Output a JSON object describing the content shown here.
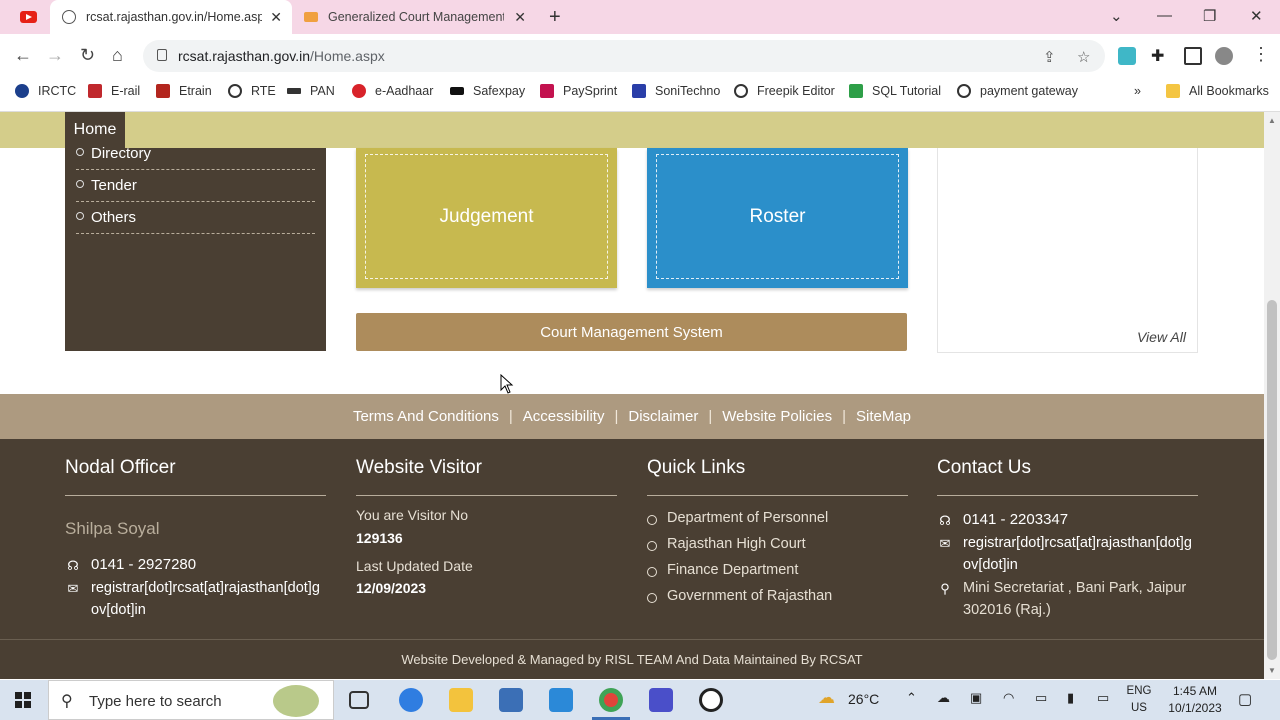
{
  "browser": {
    "tabs": [
      {
        "title": "rcsat.rajasthan.gov.in/Home.asp",
        "active": true
      },
      {
        "title": "Generalized Court Management",
        "active": false
      }
    ],
    "url_host": "rcsat.rajasthan.gov.in",
    "url_path": "/Home.aspx",
    "bookmarks": [
      "IRCTC",
      "E-rail",
      "Etrain",
      "RTE",
      "PAN",
      "e-Aadhaar",
      "Safexpay",
      "PaySprint",
      "SoniTechno",
      "Freepik Editor",
      "SQL Tutorial",
      "payment gateway"
    ],
    "all_bookmarks": "All Bookmarks",
    "more_bookmarks": "»"
  },
  "menu": {
    "home": "Home"
  },
  "left_links": [
    "Directory",
    "Tender",
    "Others"
  ],
  "tiles": {
    "judgement": "Judgement",
    "roster": "Roster",
    "cms": "Court Management System"
  },
  "news": {
    "view_all": "View All"
  },
  "footer_links": [
    "Terms And Conditions",
    "Accessibility",
    "Disclaimer",
    "Website Policies",
    "SiteMap"
  ],
  "footer": {
    "nodal": {
      "heading": "Nodal Officer",
      "name": "Shilpa Soyal",
      "phone": "0141 - 2927280",
      "email": "registrar[dot]rcsat[at]rajasthan[dot]gov[dot]in"
    },
    "visitor": {
      "heading": "Website Visitor",
      "visitor_label": "You are Visitor No",
      "visitor_no": "129136",
      "updated_label": "Last Updated Date",
      "updated_date": "12/09/2023"
    },
    "quick": {
      "heading": "Quick Links",
      "links": [
        "Department of Personnel",
        "Rajasthan High Court",
        "Finance Department",
        "Government of Rajasthan"
      ]
    },
    "contact": {
      "heading": "Contact Us",
      "phone": "0141 - 2203347",
      "email": "registrar[dot]rcsat[at]rajasthan[dot]gov[dot]in",
      "address": "Mini Secretariat , Bani Park, Jaipur 302016 (Raj.)"
    },
    "credit": "Website Developed & Managed by RISL TEAM And Data Maintained By RCSAT"
  },
  "taskbar": {
    "search_placeholder": "Type here to search",
    "weather": "26°C",
    "lang_top": "ENG",
    "lang_bottom": "US",
    "time": "1:45 AM",
    "date": "10/1/2023"
  },
  "colors": {
    "menu_bar": "#d4cd8a",
    "dark_brown": "#4a3f33",
    "judgement": "#c7b94f",
    "roster": "#2b8fca",
    "cms": "#ad8c5c",
    "footer_links_bg": "#ad9a80"
  }
}
